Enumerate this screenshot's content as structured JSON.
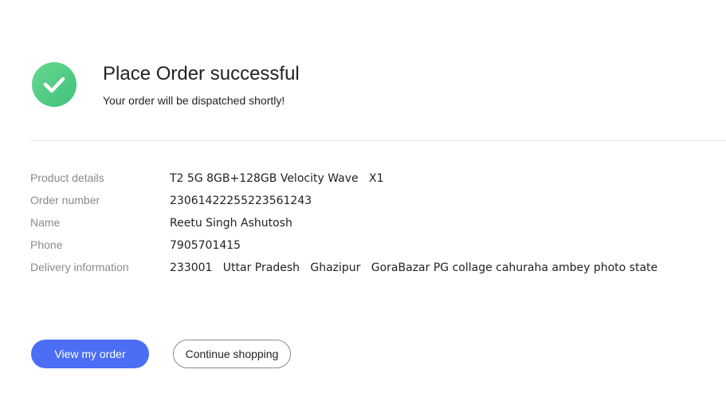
{
  "header": {
    "icon": "check-circle-icon",
    "title": "Place Order successful",
    "subtitle": "Your order will be dispatched shortly!"
  },
  "details": {
    "product_label": "Product details",
    "product_value": "T2 5G 8GB+128GB Velocity Wave   X1",
    "order_label": "Order number",
    "order_value": "2306142225522356124З",
    "name_label": "Name",
    "name_value": "Reetu Singh Ashutosh",
    "phone_label": "Phone",
    "phone_value": "7905701415",
    "delivery_label": "Delivery information",
    "delivery_value": "233001   Uttar Pradesh   Ghazipur   GoraBazar PG collage cahuraha ambey photo state"
  },
  "actions": {
    "view_order_label": "View my order",
    "continue_label": "Continue shopping"
  },
  "colors": {
    "accent": "#4b6ef5",
    "success": "#4cc97f"
  }
}
